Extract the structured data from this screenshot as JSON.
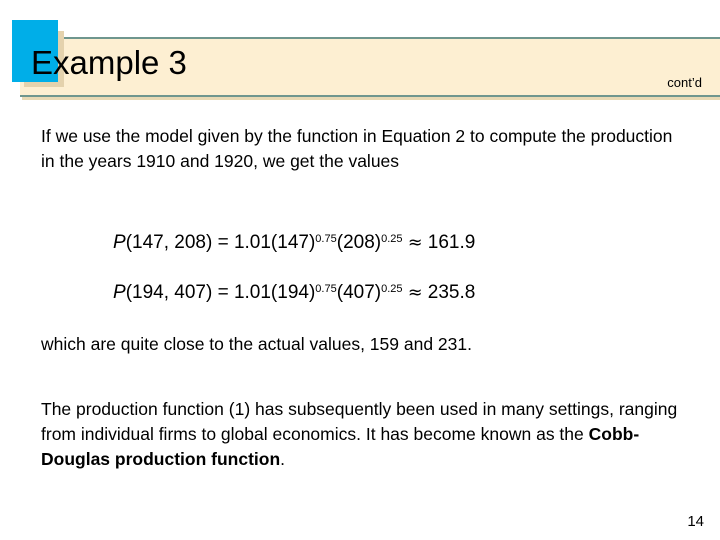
{
  "header": {
    "title": "Example 3",
    "continued_label": "cont’d",
    "accent_color": "#00aee8",
    "band_color": "#fdefd2",
    "band_rule_color": "#6f968e",
    "shadow_color": "#e4d2ad"
  },
  "body": {
    "intro_paragraph": "If we use the model given by the function in Equation 2 to compute the production in the years 1910 and 1920, we get the values",
    "equations": [
      {
        "function_symbol": "P",
        "args_text": "(147, 208) = 1.01(147)",
        "exponent_1": "0.75",
        "mid_text": "(208)",
        "exponent_2": "0.25",
        "relation": "≈",
        "result": "161.9",
        "full_text": "P(147, 208) = 1.01(147)^0.75(208)^0.25 ≈ 161.9"
      },
      {
        "function_symbol": "P",
        "args_text": "(194, 407) = 1.01(194)",
        "exponent_1": "0.75",
        "mid_text": "(407)",
        "exponent_2": "0.25",
        "relation": "≈",
        "result": "235.8",
        "full_text": "P(194, 407) = 1.01(194)^0.75(407)^0.25 ≈ 235.8"
      }
    ],
    "closing_paragraph": "which are quite close to the actual values, 159 and 231.",
    "final_paragraph": {
      "lead_text": "The production function (1) has subsequently been used in many settings, ranging from individual firms to global economics. It has become known as the ",
      "bold_term": "Cobb-Douglas production function",
      "trailing_text": "."
    }
  },
  "footer": {
    "page_number": "14"
  }
}
